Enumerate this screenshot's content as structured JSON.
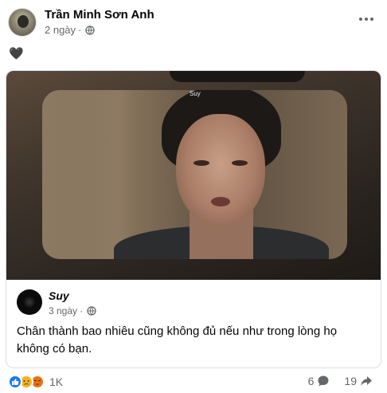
{
  "post": {
    "author": "Trần Minh Sơn Anh",
    "time": "2 ngày",
    "dot": "·",
    "text_emoji": "🖤"
  },
  "shared": {
    "watermark": "Suy",
    "author": "Suy",
    "time": "3 ngày",
    "dot": "·",
    "text": "Chân thành bao nhiêu cũng không đủ nếu như trong lòng họ không có bạn."
  },
  "footer": {
    "reaction_count": "1K",
    "comment_count": "6",
    "share_count": "19"
  },
  "colors": {
    "accent": "#1877f2",
    "secondary_text": "#65676b"
  }
}
